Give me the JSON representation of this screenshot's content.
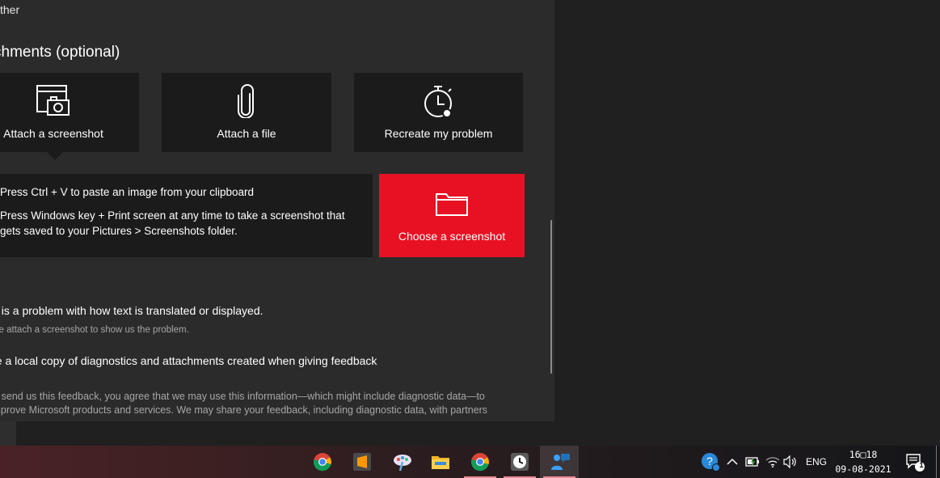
{
  "feedback": {
    "top_partial_text": "ther",
    "attachments_heading": "chments (optional)",
    "tiles": [
      {
        "label": "Attach a screenshot",
        "icon": "screenshot-icon"
      },
      {
        "label": "Attach a file",
        "icon": "paperclip-icon"
      },
      {
        "label": "Recreate my problem",
        "icon": "stopwatch-icon"
      }
    ],
    "hints": {
      "paste": "Press Ctrl + V to paste an image from your clipboard",
      "print_screen": "Press Windows key + Print screen at any time to take a screenshot that gets saved to your Pictures > Screenshots folder."
    },
    "choose_button_label": "Choose a screenshot",
    "option_translation": "his is a problem with how text is translated or displayed.",
    "option_translation_sub": "ease attach a screenshot to show us the problem.",
    "option_save_copy": "ave a local copy of diagnostics and attachments created when giving feedback",
    "legal_line1": "you send us this feedback, you agree that we may use this information—which might include diagnostic data—to",
    "legal_line2": "s improve Microsoft products and services. We may share your feedback, including diagnostic data, with partners"
  },
  "taskbar": {
    "apps": [
      {
        "icon": "chrome-icon"
      },
      {
        "icon": "sublime-text-icon"
      },
      {
        "icon": "paint-3d-icon"
      },
      {
        "icon": "file-explorer-icon"
      },
      {
        "icon": "chrome-icon"
      },
      {
        "icon": "clock-app-icon"
      },
      {
        "icon": "feedback-hub-icon"
      }
    ],
    "tray": {
      "language": "ENG",
      "time": "16□18",
      "date": "09-08-2021",
      "notification_count": "1"
    }
  },
  "colors": {
    "accent_red": "#e81123",
    "panel_bg": "#2b2b2b",
    "tile_bg": "#1b1b1b"
  }
}
